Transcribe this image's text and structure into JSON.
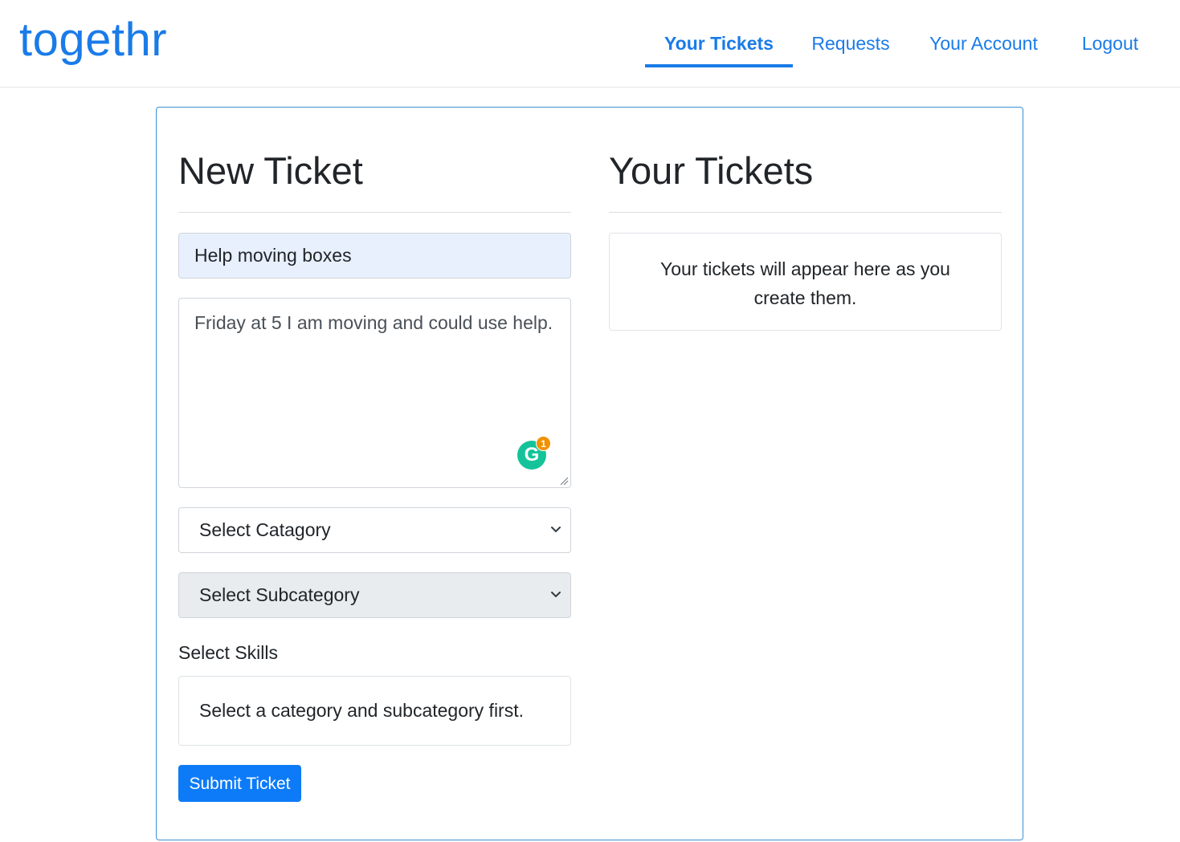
{
  "header": {
    "brand": "togethr",
    "nav": [
      {
        "label": "Your Tickets",
        "active": true
      },
      {
        "label": "Requests",
        "active": false
      },
      {
        "label": "Your Account",
        "active": false
      },
      {
        "label": "Logout",
        "active": false
      }
    ]
  },
  "new_ticket": {
    "heading": "New Ticket",
    "title_value": "Help moving boxes",
    "description_value": "Friday at 5 I am moving and could use help.",
    "grammarly": {
      "icon": "grammarly-icon",
      "letter": "G",
      "badge_count": "1"
    },
    "category_select": {
      "selected": "Select Catagory",
      "disabled": false
    },
    "subcategory_select": {
      "selected": "Select Subcategory",
      "disabled": true
    },
    "skills_label": "Select Skills",
    "skills_placeholder": "Select a category and subcategory first.",
    "submit_label": "Submit Ticket"
  },
  "your_tickets": {
    "heading": "Your Tickets",
    "empty_message": "Your tickets will appear here as you create them."
  },
  "colors": {
    "brand": "#1a7be8",
    "primary_button": "#0d7bf7",
    "card_border": "#3b8fd6",
    "autofill_bg": "#e8f0fe",
    "disabled_bg": "#e9ecef",
    "grammarly_green": "#15c39a",
    "grammarly_badge": "#f29100"
  }
}
